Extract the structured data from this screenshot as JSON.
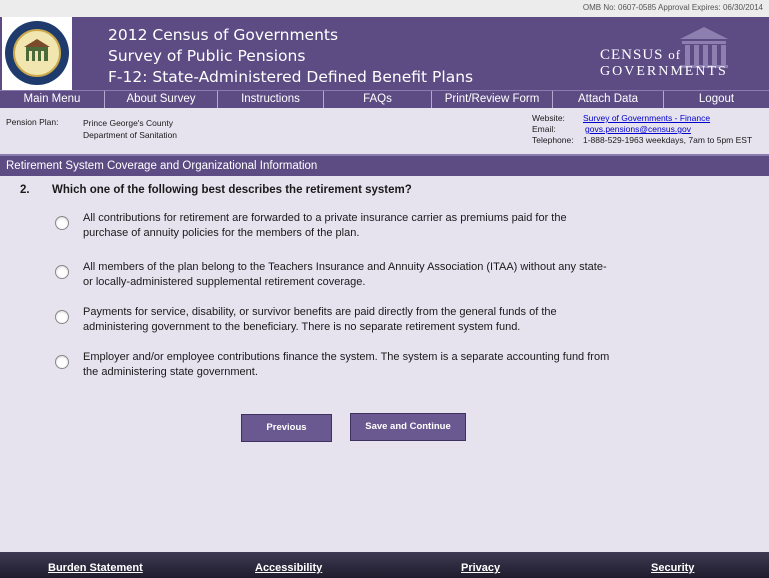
{
  "omb": "OMB No:  0607-0585  Approval Expires:  06/30/2014",
  "header": {
    "title_line1": "2012 Census of Governments",
    "title_line2": "Survey of Public Pensions",
    "title_line3": "F-12:  State-Administered Defined Benefit Plans",
    "cog_line1": "CENSUS",
    "cog_of": "of",
    "cog_line2": "GOVERNMENTS",
    "seal_text": "U.S. DEPARTMENT OF COMMERCE · BUREAU OF THE CENSUS"
  },
  "nav": [
    {
      "label": "Main Menu"
    },
    {
      "label": "About Survey"
    },
    {
      "label": "Instructions"
    },
    {
      "label": "FAQs"
    },
    {
      "label": "Print/Review Form"
    },
    {
      "label": "Attach Data"
    },
    {
      "label": "Logout"
    }
  ],
  "info": {
    "pension_plan_label": "Pension Plan:",
    "pension_plan_line1": "Prince George's County",
    "pension_plan_line2": "Department of Sanitation",
    "website_label": "Website:",
    "website_value": "Survey of Governments - Finance",
    "email_label": "Email:",
    "email_value": "govs.pensions@census.gov",
    "telephone_label": "Telephone:",
    "telephone_value": "1-888-529-1963  weekdays, 7am to 5pm EST"
  },
  "section_title": "Retirement System Coverage and Organizational Information",
  "question": {
    "number": "2.",
    "text": "Which one of the following best describes the retirement system?",
    "options": [
      {
        "line1": "All contributions for retirement are forwarded to a private insurance carrier as premiums paid for the",
        "line2": "purchase of annuity policies for the members of the plan."
      },
      {
        "line1": "All members of the plan belong to the Teachers Insurance and Annuity Association (ITAA) without any state-",
        "line2": "or locally-administered supplemental retirement coverage."
      },
      {
        "line1": "Payments for service, disability, or survivor benefits are paid directly from the general funds of the",
        "line2": "administering government to the beneficiary.  There is no separate retirement system fund."
      },
      {
        "line1": "Employer and/or employee contributions finance the system.  The system is a separate accounting fund from",
        "line2": "the administering state government."
      }
    ]
  },
  "buttons": {
    "previous": "Previous",
    "save_continue": "Save and Continue"
  },
  "footer": {
    "burden": "Burden Statement",
    "accessibility": "Accessibility",
    "privacy": "Privacy",
    "security": "Security"
  }
}
